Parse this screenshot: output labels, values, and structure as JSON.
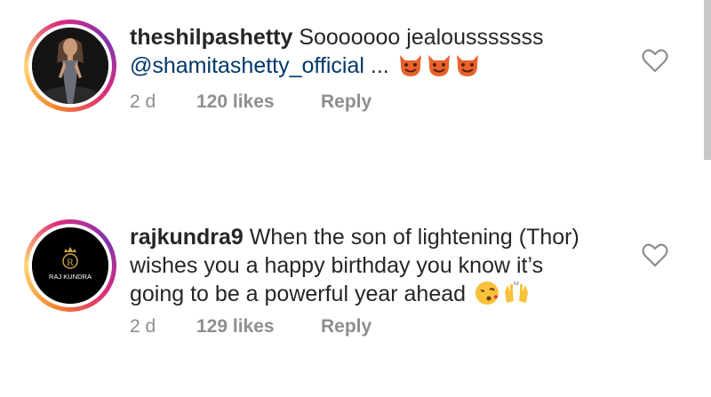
{
  "comments": [
    {
      "username": "theshilpashetty",
      "text": " Sooooooo jealousssssss",
      "mention": "@shamitashetty_official",
      "trailing": " ...",
      "emojis": [
        "devil-face",
        "devil-face",
        "devil-face"
      ],
      "time": "2 d",
      "likes": "120 likes",
      "reply": "Reply"
    },
    {
      "username": "rajkundra9",
      "text_line1": " When the son of lightening (Thor)",
      "text_line2": "wishes you a happy birthday you know it’s",
      "text_line3": "going to be a powerful year ahead ",
      "emojis": [
        "kiss-face",
        "raising-hands"
      ],
      "avatar_text": "RAJ KUNDRA",
      "avatar_letter": "R",
      "time": "2 d",
      "likes": "129 likes",
      "reply": "Reply"
    }
  ],
  "colors": {
    "text": "#262626",
    "mention": "#00376b",
    "meta": "#8e8e8e"
  }
}
